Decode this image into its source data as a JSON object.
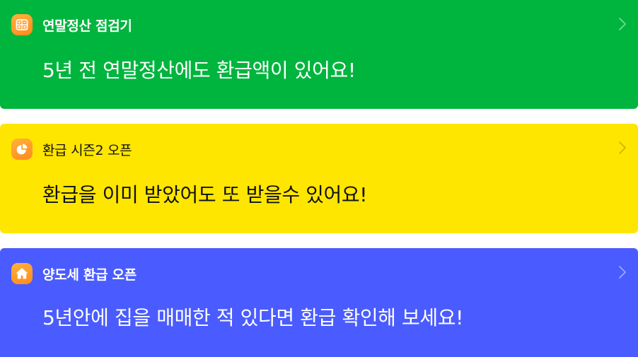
{
  "cards": [
    {
      "title": "연말정산 점검기",
      "body": "5년 전 연말정산에도 환급액이 있어요!",
      "icon": "calculator-icon",
      "background": "#00b53e",
      "text_color": "#ffffff",
      "chevron_color": "#7fd99a"
    },
    {
      "title": "환급 시즌2 오픈",
      "body": "환급을 이미 받았어도 또 받을수 있어요!",
      "icon": "pie-chart-icon",
      "background": "#ffe600",
      "text_color": "#111111",
      "chevron_color": "#c9b400"
    },
    {
      "title": "양도세 환급 오픈",
      "body": "5년안에 집을 매매한 적 있다면 환급 확인해 보세요!",
      "icon": "house-icon",
      "background": "#4a5cff",
      "text_color": "#ffffff",
      "chevron_color": "#a3acff"
    }
  ]
}
